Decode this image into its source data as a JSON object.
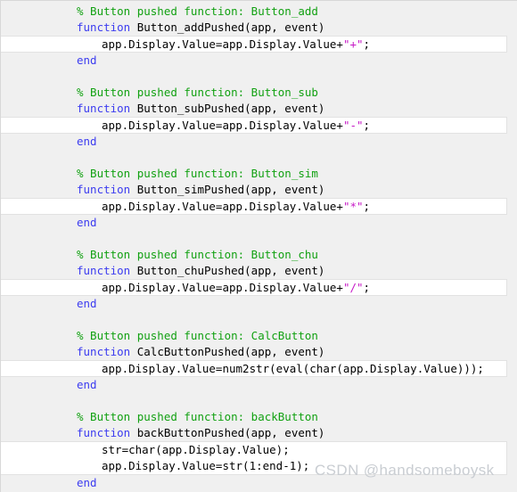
{
  "editor": {
    "language": "MATLAB",
    "background_color": "#f0f0f0",
    "highlight_row_color": "#ffffff",
    "colors": {
      "comment": "#12a112",
      "keyword": "#3c3cf0",
      "string": "#c618c6",
      "plain": "#000000"
    }
  },
  "watermark": {
    "text": "CSDN @handsomeboysk",
    "color": "#c9cdd2"
  },
  "code": {
    "lines": [
      {
        "id": "l1",
        "style": "normal",
        "indent": 85,
        "tokens": [
          {
            "cls": "cmt",
            "t": "% Button pushed function: Button_add"
          }
        ]
      },
      {
        "id": "l2",
        "style": "normal",
        "indent": 85,
        "tokens": [
          {
            "cls": "kw",
            "t": "function"
          },
          {
            "cls": "pln",
            "t": " Button_addPushed(app, event)"
          }
        ]
      },
      {
        "id": "l3",
        "style": "hl",
        "indent": 113,
        "tokens": [
          {
            "cls": "pln",
            "t": "app.Display.Value=app.Display.Value+"
          },
          {
            "cls": "str",
            "t": "\"+\""
          },
          {
            "cls": "pln",
            "t": ";"
          }
        ]
      },
      {
        "id": "l4",
        "style": "normal",
        "indent": 85,
        "tokens": [
          {
            "cls": "kw",
            "t": "end"
          }
        ]
      },
      {
        "id": "l5",
        "style": "blank",
        "indent": 85,
        "tokens": [
          {
            "cls": "pln",
            "t": ""
          }
        ]
      },
      {
        "id": "l6",
        "style": "normal",
        "indent": 85,
        "tokens": [
          {
            "cls": "cmt",
            "t": "% Button pushed function: Button_sub"
          }
        ]
      },
      {
        "id": "l7",
        "style": "normal",
        "indent": 85,
        "tokens": [
          {
            "cls": "kw",
            "t": "function"
          },
          {
            "cls": "pln",
            "t": " Button_subPushed(app, event)"
          }
        ]
      },
      {
        "id": "l8",
        "style": "hl",
        "indent": 113,
        "tokens": [
          {
            "cls": "pln",
            "t": "app.Display.Value=app.Display.Value+"
          },
          {
            "cls": "str",
            "t": "\"-\""
          },
          {
            "cls": "pln",
            "t": ";"
          }
        ]
      },
      {
        "id": "l9",
        "style": "normal",
        "indent": 85,
        "tokens": [
          {
            "cls": "kw",
            "t": "end"
          }
        ]
      },
      {
        "id": "l10",
        "style": "blank",
        "indent": 85,
        "tokens": [
          {
            "cls": "pln",
            "t": ""
          }
        ]
      },
      {
        "id": "l11",
        "style": "normal",
        "indent": 85,
        "tokens": [
          {
            "cls": "cmt",
            "t": "% Button pushed function: Button_sim"
          }
        ]
      },
      {
        "id": "l12",
        "style": "normal",
        "indent": 85,
        "tokens": [
          {
            "cls": "kw",
            "t": "function"
          },
          {
            "cls": "pln",
            "t": " Button_simPushed(app, event)"
          }
        ]
      },
      {
        "id": "l13",
        "style": "hl",
        "indent": 113,
        "tokens": [
          {
            "cls": "pln",
            "t": "app.Display.Value=app.Display.Value+"
          },
          {
            "cls": "str",
            "t": "\"*\""
          },
          {
            "cls": "pln",
            "t": ";"
          }
        ]
      },
      {
        "id": "l14",
        "style": "normal",
        "indent": 85,
        "tokens": [
          {
            "cls": "kw",
            "t": "end"
          }
        ]
      },
      {
        "id": "l15",
        "style": "blank",
        "indent": 85,
        "tokens": [
          {
            "cls": "pln",
            "t": ""
          }
        ]
      },
      {
        "id": "l16",
        "style": "normal",
        "indent": 85,
        "tokens": [
          {
            "cls": "cmt",
            "t": "% Button pushed function: Button_chu"
          }
        ]
      },
      {
        "id": "l17",
        "style": "normal",
        "indent": 85,
        "tokens": [
          {
            "cls": "kw",
            "t": "function"
          },
          {
            "cls": "pln",
            "t": " Button_chuPushed(app, event)"
          }
        ]
      },
      {
        "id": "l18",
        "style": "hl",
        "indent": 113,
        "tokens": [
          {
            "cls": "pln",
            "t": "app.Display.Value=app.Display.Value+"
          },
          {
            "cls": "str",
            "t": "\"/\""
          },
          {
            "cls": "pln",
            "t": ";"
          }
        ]
      },
      {
        "id": "l19",
        "style": "normal",
        "indent": 85,
        "tokens": [
          {
            "cls": "kw",
            "t": "end"
          }
        ]
      },
      {
        "id": "l20",
        "style": "blank",
        "indent": 85,
        "tokens": [
          {
            "cls": "pln",
            "t": ""
          }
        ]
      },
      {
        "id": "l21",
        "style": "normal",
        "indent": 85,
        "tokens": [
          {
            "cls": "cmt",
            "t": "% Button pushed function: CalcButton"
          }
        ]
      },
      {
        "id": "l22",
        "style": "normal",
        "indent": 85,
        "tokens": [
          {
            "cls": "kw",
            "t": "function"
          },
          {
            "cls": "pln",
            "t": " CalcButtonPushed(app, event)"
          }
        ]
      },
      {
        "id": "l23",
        "style": "hl",
        "indent": 113,
        "tokens": [
          {
            "cls": "pln",
            "t": "app.Display.Value=num2str(eval(char(app.Display.Value)));"
          }
        ]
      },
      {
        "id": "l24",
        "style": "normal",
        "indent": 85,
        "tokens": [
          {
            "cls": "kw",
            "t": "end"
          }
        ]
      },
      {
        "id": "l25",
        "style": "blank",
        "indent": 85,
        "tokens": [
          {
            "cls": "pln",
            "t": ""
          }
        ]
      },
      {
        "id": "l26",
        "style": "normal",
        "indent": 85,
        "tokens": [
          {
            "cls": "cmt",
            "t": "% Button pushed function: backButton"
          }
        ]
      },
      {
        "id": "l27",
        "style": "normal",
        "indent": 85,
        "tokens": [
          {
            "cls": "kw",
            "t": "function"
          },
          {
            "cls": "pln",
            "t": " backButtonPushed(app, event)"
          }
        ]
      },
      {
        "id": "l28",
        "style": "hl first",
        "indent": 113,
        "tokens": [
          {
            "cls": "pln",
            "t": "str=char(app.Display.Value);"
          }
        ]
      },
      {
        "id": "l29",
        "style": "hl last",
        "indent": 113,
        "tokens": [
          {
            "cls": "pln",
            "t": "app.Display.Value=str(1:end-1);"
          }
        ]
      },
      {
        "id": "l30",
        "style": "normal",
        "indent": 85,
        "tokens": [
          {
            "cls": "kw",
            "t": "end"
          }
        ]
      }
    ]
  }
}
